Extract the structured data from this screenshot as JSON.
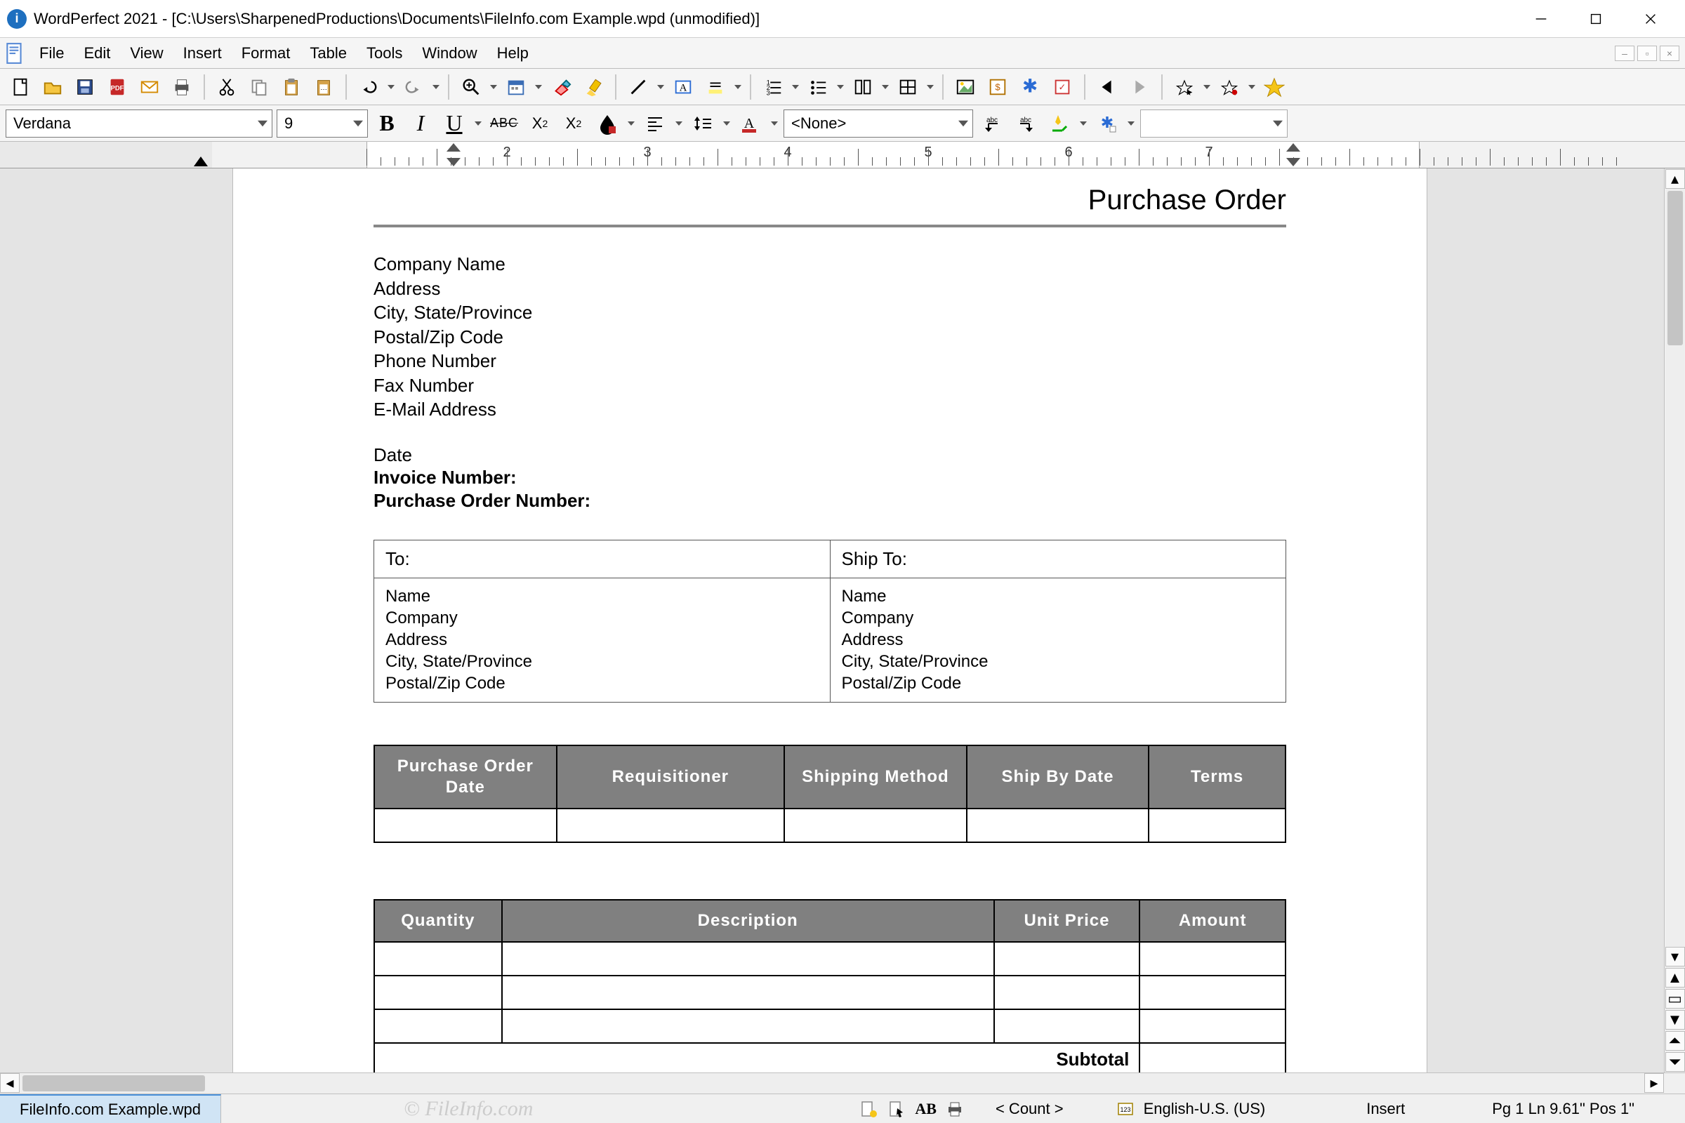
{
  "window": {
    "title": "WordPerfect 2021 - [C:\\Users\\SharpenedProductions\\Documents\\FileInfo.com Example.wpd (unmodified)]"
  },
  "menu": {
    "items": [
      "File",
      "Edit",
      "View",
      "Insert",
      "Format",
      "Table",
      "Tools",
      "Window",
      "Help"
    ]
  },
  "format": {
    "font": "Verdana",
    "size": "9",
    "style": "<None>"
  },
  "ruler": {
    "numbers": [
      "2",
      "3",
      "4",
      "5",
      "6",
      "7"
    ]
  },
  "document": {
    "title": "Purchase Order",
    "company_block": [
      "Company Name",
      "Address",
      "City, State/Province",
      "Postal/Zip Code",
      "Phone Number",
      "Fax Number",
      "E-Mail Address"
    ],
    "meta": {
      "date": "Date",
      "invoice_label": "Invoice Number:",
      "po_label": "Purchase Order Number:"
    },
    "address": {
      "to_label": "To:",
      "ship_label": "Ship To:",
      "fields": [
        "Name",
        "Company",
        "Address",
        "City, State/Province",
        "Postal/Zip Code"
      ]
    },
    "order_headers": [
      "Purchase Order Date",
      "Requisitioner",
      "Shipping Method",
      "Ship By Date",
      "Terms"
    ],
    "item_headers": [
      "Quantity",
      "Description",
      "Unit Price",
      "Amount"
    ],
    "subtotal_label": "Subtotal"
  },
  "tabs": {
    "active": "FileInfo.com Example.wpd"
  },
  "watermark": "© FileInfo.com",
  "status": {
    "count": "< Count >",
    "lang": "English-U.S. (US)",
    "mode": "Insert",
    "pos": "Pg 1 Ln 9.61\" Pos 1\""
  }
}
